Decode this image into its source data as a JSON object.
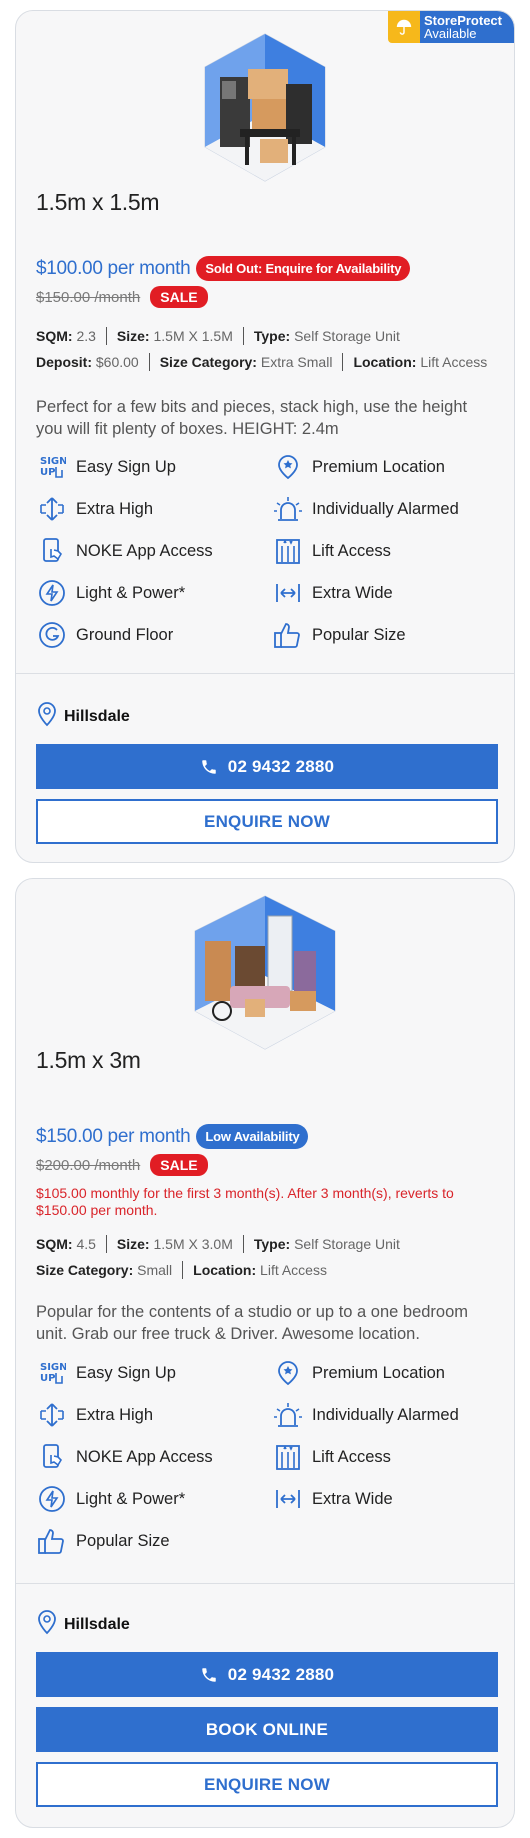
{
  "colors": {
    "accent": "#2f6fce",
    "sale_red": "#e11d24",
    "promo_red": "#d9242a",
    "badge_yellow": "#f6b81b"
  },
  "units": [
    {
      "badge": {
        "line1": "StoreProtect",
        "line2": "Available",
        "icon": "umbrella-icon"
      },
      "image": "storage-unit-illustration",
      "title": "1.5m x 1.5m",
      "price": "$100.00 per month",
      "availability": "Sold Out: Enquire for Availability",
      "old_price": "$150.00 /month",
      "sale_label": "SALE",
      "specs": {
        "sqm_label": "SQM:",
        "sqm": "2.3",
        "size_label": "Size:",
        "size": "1.5M X 1.5M",
        "type_label": "Type:",
        "type": "Self Storage Unit",
        "deposit_label": "Deposit:",
        "deposit": "$60.00",
        "category_label": "Size Category:",
        "category": "Extra Small",
        "location_label": "Location:",
        "location": "Lift Access"
      },
      "description": "Perfect for a few bits and pieces, stack high, use the height you will fit plenty of boxes. HEIGHT: 2.4m",
      "features": [
        "Easy Sign Up",
        "Premium Location",
        "Extra High",
        "Individually Alarmed",
        "NOKE App Access",
        "Lift Access",
        "Light & Power*",
        "Extra Wide",
        "Ground Floor",
        "Popular Size"
      ],
      "facility": "Hillsdale",
      "phone": "02 9432 2880",
      "enquire": "ENQUIRE NOW"
    },
    {
      "image": "storage-unit-illustration",
      "title": "1.5m x 3m",
      "price": "$150.00 per month",
      "availability": "Low Availability",
      "old_price": "$200.00 /month",
      "sale_label": "SALE",
      "promo": "$105.00 monthly for the first 3 month(s). After 3 month(s), reverts to $150.00 per month.",
      "specs": {
        "sqm_label": "SQM:",
        "sqm": "4.5",
        "size_label": "Size:",
        "size": "1.5M X 3.0M",
        "type_label": "Type:",
        "type": "Self Storage Unit",
        "category_label": "Size Category:",
        "category": "Small",
        "location_label": "Location:",
        "location": "Lift Access"
      },
      "description": "Popular for the contents of a studio or up to a one bedroom unit. Grab our free truck & Driver. Awesome location.",
      "features": [
        "Easy Sign Up",
        "Premium Location",
        "Extra High",
        "Individually Alarmed",
        "NOKE App Access",
        "Lift Access",
        "Light & Power*",
        "Extra Wide",
        "Popular Size"
      ],
      "facility": "Hillsdale",
      "phone": "02 9432 2880",
      "book": "BOOK ONLINE",
      "enquire": "ENQUIRE NOW"
    }
  ]
}
